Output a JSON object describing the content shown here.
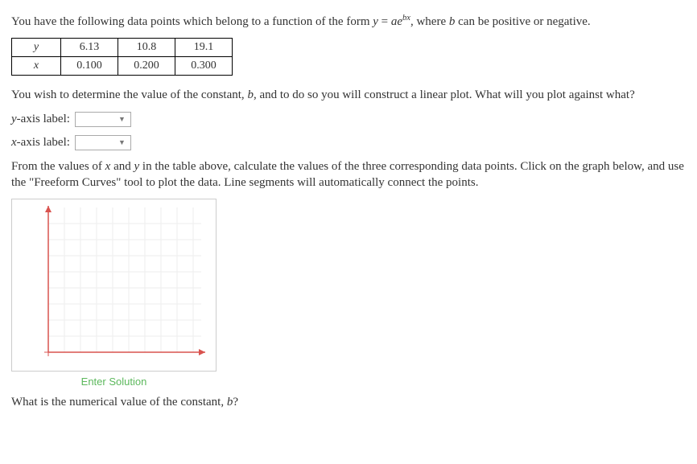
{
  "intro": "You have the following data points which belong to a function of the form ",
  "equation_lhs": "y",
  "equation_eq": " = ",
  "equation_a": "a",
  "equation_e": "e",
  "equation_exp": "bx",
  "intro_tail": ", where ",
  "intro_b": "b",
  "intro_tail2": " can be positive or negative.",
  "table": {
    "row1_label": "y",
    "row1": [
      "6.13",
      "10.8",
      "19.1"
    ],
    "row2_label": "x",
    "row2": [
      "0.100",
      "0.200",
      "0.300"
    ]
  },
  "para2a": "You wish to determine the value of the constant, ",
  "para2b": "b",
  "para2c": ", and to do so you will construct a linear plot. What will you plot against what?",
  "yaxis_label_prefix": "y",
  "yaxis_label_suffix": "-axis label:",
  "xaxis_label_prefix": "x",
  "xaxis_label_suffix": "-axis label:",
  "para3a": "From the values of ",
  "para3_x": "x",
  "para3_and": " and ",
  "para3_y": "y",
  "para3b": " in the table above, calculate the values of the three corresponding data points. Click on the graph below, and use the \"Freeform Curves\" tool to plot the data. Line segments will automatically connect the points.",
  "enter_solution": "Enter Solution",
  "final_q_a": "What is the numerical value of the constant, ",
  "final_q_b": "b",
  "final_q_c": "?"
}
